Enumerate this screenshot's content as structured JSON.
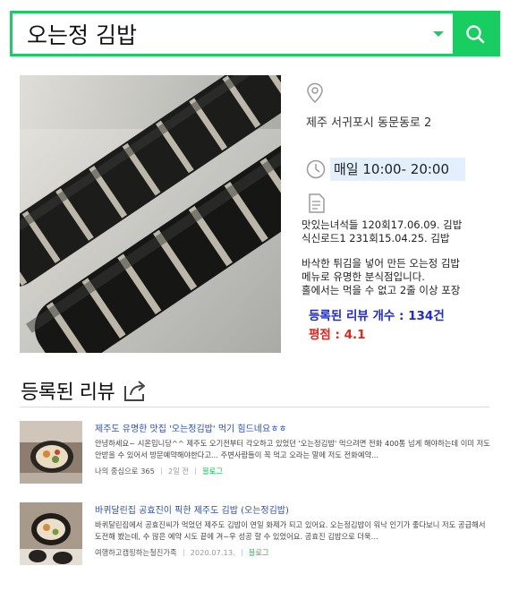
{
  "search": {
    "query": "오는정 김밥"
  },
  "place": {
    "address": "제주 서귀포시 동문동로 2",
    "hours": "매일 10:00- 20:00",
    "history": [
      "맛있는녀석들 120회17.06.09. 김밥",
      "식신로드1 231회15.04.25. 김밥"
    ],
    "description": [
      "바삭한 튀김을 넣어 만든 오는정 김밥",
      "메뉴로 유명한 분식점입니다.",
      "홀에서는 먹을 수 없고 2줄 이상 포장"
    ],
    "review_count": "등록된 리뷰 개수 : 134건",
    "rating": "평점 : 4.1"
  },
  "reviews_section": {
    "title": "등록된 리뷰"
  },
  "reviews": [
    {
      "title": "제주도 유명한 맛집 '오는정김밥' 먹기 힘드네요ㅎㅎ",
      "snippet": "안녕하세요~ 시온입니당^^ 제주도 오기전부터 각오하고 있었던 '오는정김밥' 먹으려면 전화 400통 넘게 해야하는데 이미 저도 안받을 수 있어서 방문예약해야한다고... 주변사람들이 꼭 먹고 오라는 말에 저도 전화예약...",
      "author": "나의 중심으로 365",
      "date": "2일 전",
      "source": "블로그"
    },
    {
      "title": "바퀴달린집 공효진이 픽한 제주도 김밥 (오는정김밥)",
      "snippet": "바퀴달린집에서 공효진씨가 먹었던 제주도 김밥이 연일 화제가 되고 있어요. 오는정김밥이 워낙 인기가 좋다보니 저도 공급해서 도전해 봤는데, 수 많은 예약 시도 끝에 겨~우 성공 할 수 있었어요. 공효진 김밥으로 더욱...",
      "author": "여행하고캠핑하는철진가족",
      "date": "2020.07.13.",
      "source": "블로그"
    }
  ],
  "colors": {
    "accent": "#19ce60",
    "review_count": "#1f2bd0",
    "rating": "#e8231a",
    "link": "#2a4fb8"
  }
}
